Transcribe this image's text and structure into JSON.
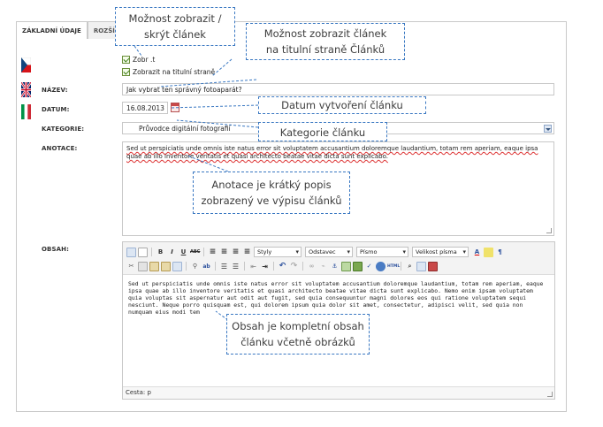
{
  "tabs": [
    {
      "label": "ZÁKLADNÍ ÚDAJE",
      "active": true
    },
    {
      "label": "ROZŠÍŘE",
      "active": false
    }
  ],
  "flags": [
    "czech-flag-icon",
    "uk-flag-icon",
    "italy-flag-icon"
  ],
  "checkboxes": {
    "show": {
      "label": "Zobra...",
      "label_visible": "Zobr  .t",
      "checked": true
    },
    "homepage": {
      "label": "Zobrazit na titulní straně",
      "checked": true
    }
  },
  "fields": {
    "name": {
      "label": "NÁZEV:",
      "value": "Jak vybrat ten správný fotoaparát?"
    },
    "date": {
      "label": "DATUM:",
      "value": "16.08.2013"
    },
    "category": {
      "label": "KATEGORIE:",
      "value": "Průvodce digitální fotografií"
    },
    "annotation": {
      "label": "ANOTACE:",
      "value_spell": "Sed ut perspiciatis unde omnis iste natus error sit voluptatem accusantium doloremque laudantium, totam rem aperiam, eaque ipsa quae ab illo inventore veritatis et quasi architecto beatae vitae dicta sunt explicabo."
    },
    "content": {
      "label": "OBSAH:",
      "value": "Sed ut perspiciatis unde omnis iste natus error sit voluptatem accusantium doloremque laudantium, totam rem aperiam, eaque ipsa quae ab illo inventore veritatis et quasi architecto beatae vitae dicta sunt explicabo. Nemo enim ipsam voluptatem quia voluptas sit aspernatur aut odit aut fugit, sed quia consequuntur magni dolores eos qui ratione voluptatem sequi nesciunt. Neque porro quisquam est, qui dolorem ipsum quia dolor sit amet, consectetur, adipisci velit, sed quia non numquam eius modi tem"
    }
  },
  "editor": {
    "styles": "Styly",
    "format": "Odstavec",
    "font": "Písmo",
    "size": "Velikost písma",
    "path": "Cesta: p"
  },
  "callouts": {
    "show_hide": [
      "Možnost zobrazit /",
      "skrýt článek"
    ],
    "homepage": [
      "Možnost zobrazit článek",
      "na titulní straně Článků"
    ],
    "date": [
      "Datum vytvoření článku"
    ],
    "category": [
      "Kategorie článku"
    ],
    "annotation": [
      "Anotace je krátký popis",
      "zobrazený ve výpisu článků"
    ],
    "content": [
      "Obsah je kompletní obsah",
      "článku včetně obrázků"
    ]
  },
  "colors": {
    "callout_border": "#3a78c2",
    "accent_check": "#3b7a12"
  }
}
